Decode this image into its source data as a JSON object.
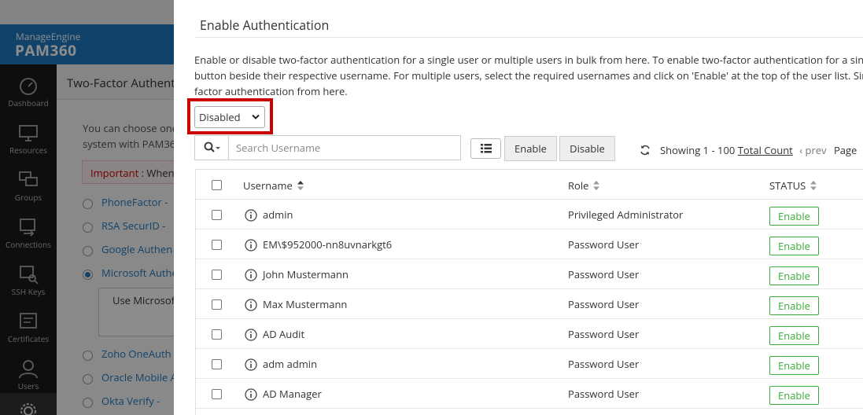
{
  "app": {
    "brand_top": "ManageEngine",
    "brand_main": "PAM360",
    "nav": [
      {
        "label": "Dashboard",
        "icon": "dashboard-icon"
      },
      {
        "label": "Resources",
        "icon": "monitor-icon"
      },
      {
        "label": "Groups",
        "icon": "groups-icon"
      },
      {
        "label": "Connections",
        "icon": "connections-icon"
      },
      {
        "label": "SSH Keys",
        "icon": "ssh-key-icon"
      },
      {
        "label": "Certificates",
        "icon": "certificate-icon"
      },
      {
        "label": "Users",
        "icon": "user-icon"
      }
    ],
    "page_title": "Two-Factor Authent",
    "intro_line1": "You can choose one",
    "intro_line2": "system with PAM36",
    "important_label": "Important",
    "important_text": " : When",
    "options": [
      {
        "label": "PhoneFactor -",
        "checked": false
      },
      {
        "label": "RSA SecurID  -",
        "checked": false
      },
      {
        "label": "Google Authen",
        "checked": false
      },
      {
        "label": "Microsoft Authe",
        "checked": true
      },
      {
        "label": "Zoho OneAuth",
        "checked": false
      },
      {
        "label": "Oracle Mobile A",
        "checked": false
      },
      {
        "label": "Okta Verify -",
        "checked": false
      }
    ],
    "textbox_text": "Use Microsof"
  },
  "panel": {
    "title": "Enable Authentication",
    "description": [
      "Enable or disable two-factor authentication for a single user or multiple users in bulk from here. To enable two-factor authentication for a sin",
      "button beside their respective username. For multiple users, select the required usernames and click on 'Enable' at the top of the user list. Sin",
      "factor authentication from here."
    ],
    "filter": {
      "selected": "Disabled"
    },
    "search": {
      "placeholder": "Search Username"
    },
    "toolbar": {
      "enable_label": "Enable",
      "disable_label": "Disable"
    },
    "paging": {
      "showing": "Showing 1 - 100 ",
      "total_count": "Total Count",
      "prev": "prev",
      "page": "Page"
    },
    "table": {
      "columns": {
        "username": "Username",
        "role": "Role",
        "status": "STATUS"
      },
      "rows": [
        {
          "username": "admin",
          "role": "Privileged Administrator",
          "status_action": "Enable"
        },
        {
          "username": "EM\\$952000-nn8uvnarkgt6",
          "role": "Password User",
          "status_action": "Enable"
        },
        {
          "username": "John Mustermann",
          "role": "Password User",
          "status_action": "Enable"
        },
        {
          "username": "Max Mustermann",
          "role": "Password User",
          "status_action": "Enable"
        },
        {
          "username": "AD Audit",
          "role": "Password User",
          "status_action": "Enable"
        },
        {
          "username": "adm admin",
          "role": "Password User",
          "status_action": "Enable"
        },
        {
          "username": "AD Manager",
          "role": "Password User",
          "status_action": "Enable"
        }
      ]
    }
  },
  "colors": {
    "brand": "#1f7ac2",
    "highlight": "#cc0000",
    "status_green": "#3aaa3a"
  }
}
